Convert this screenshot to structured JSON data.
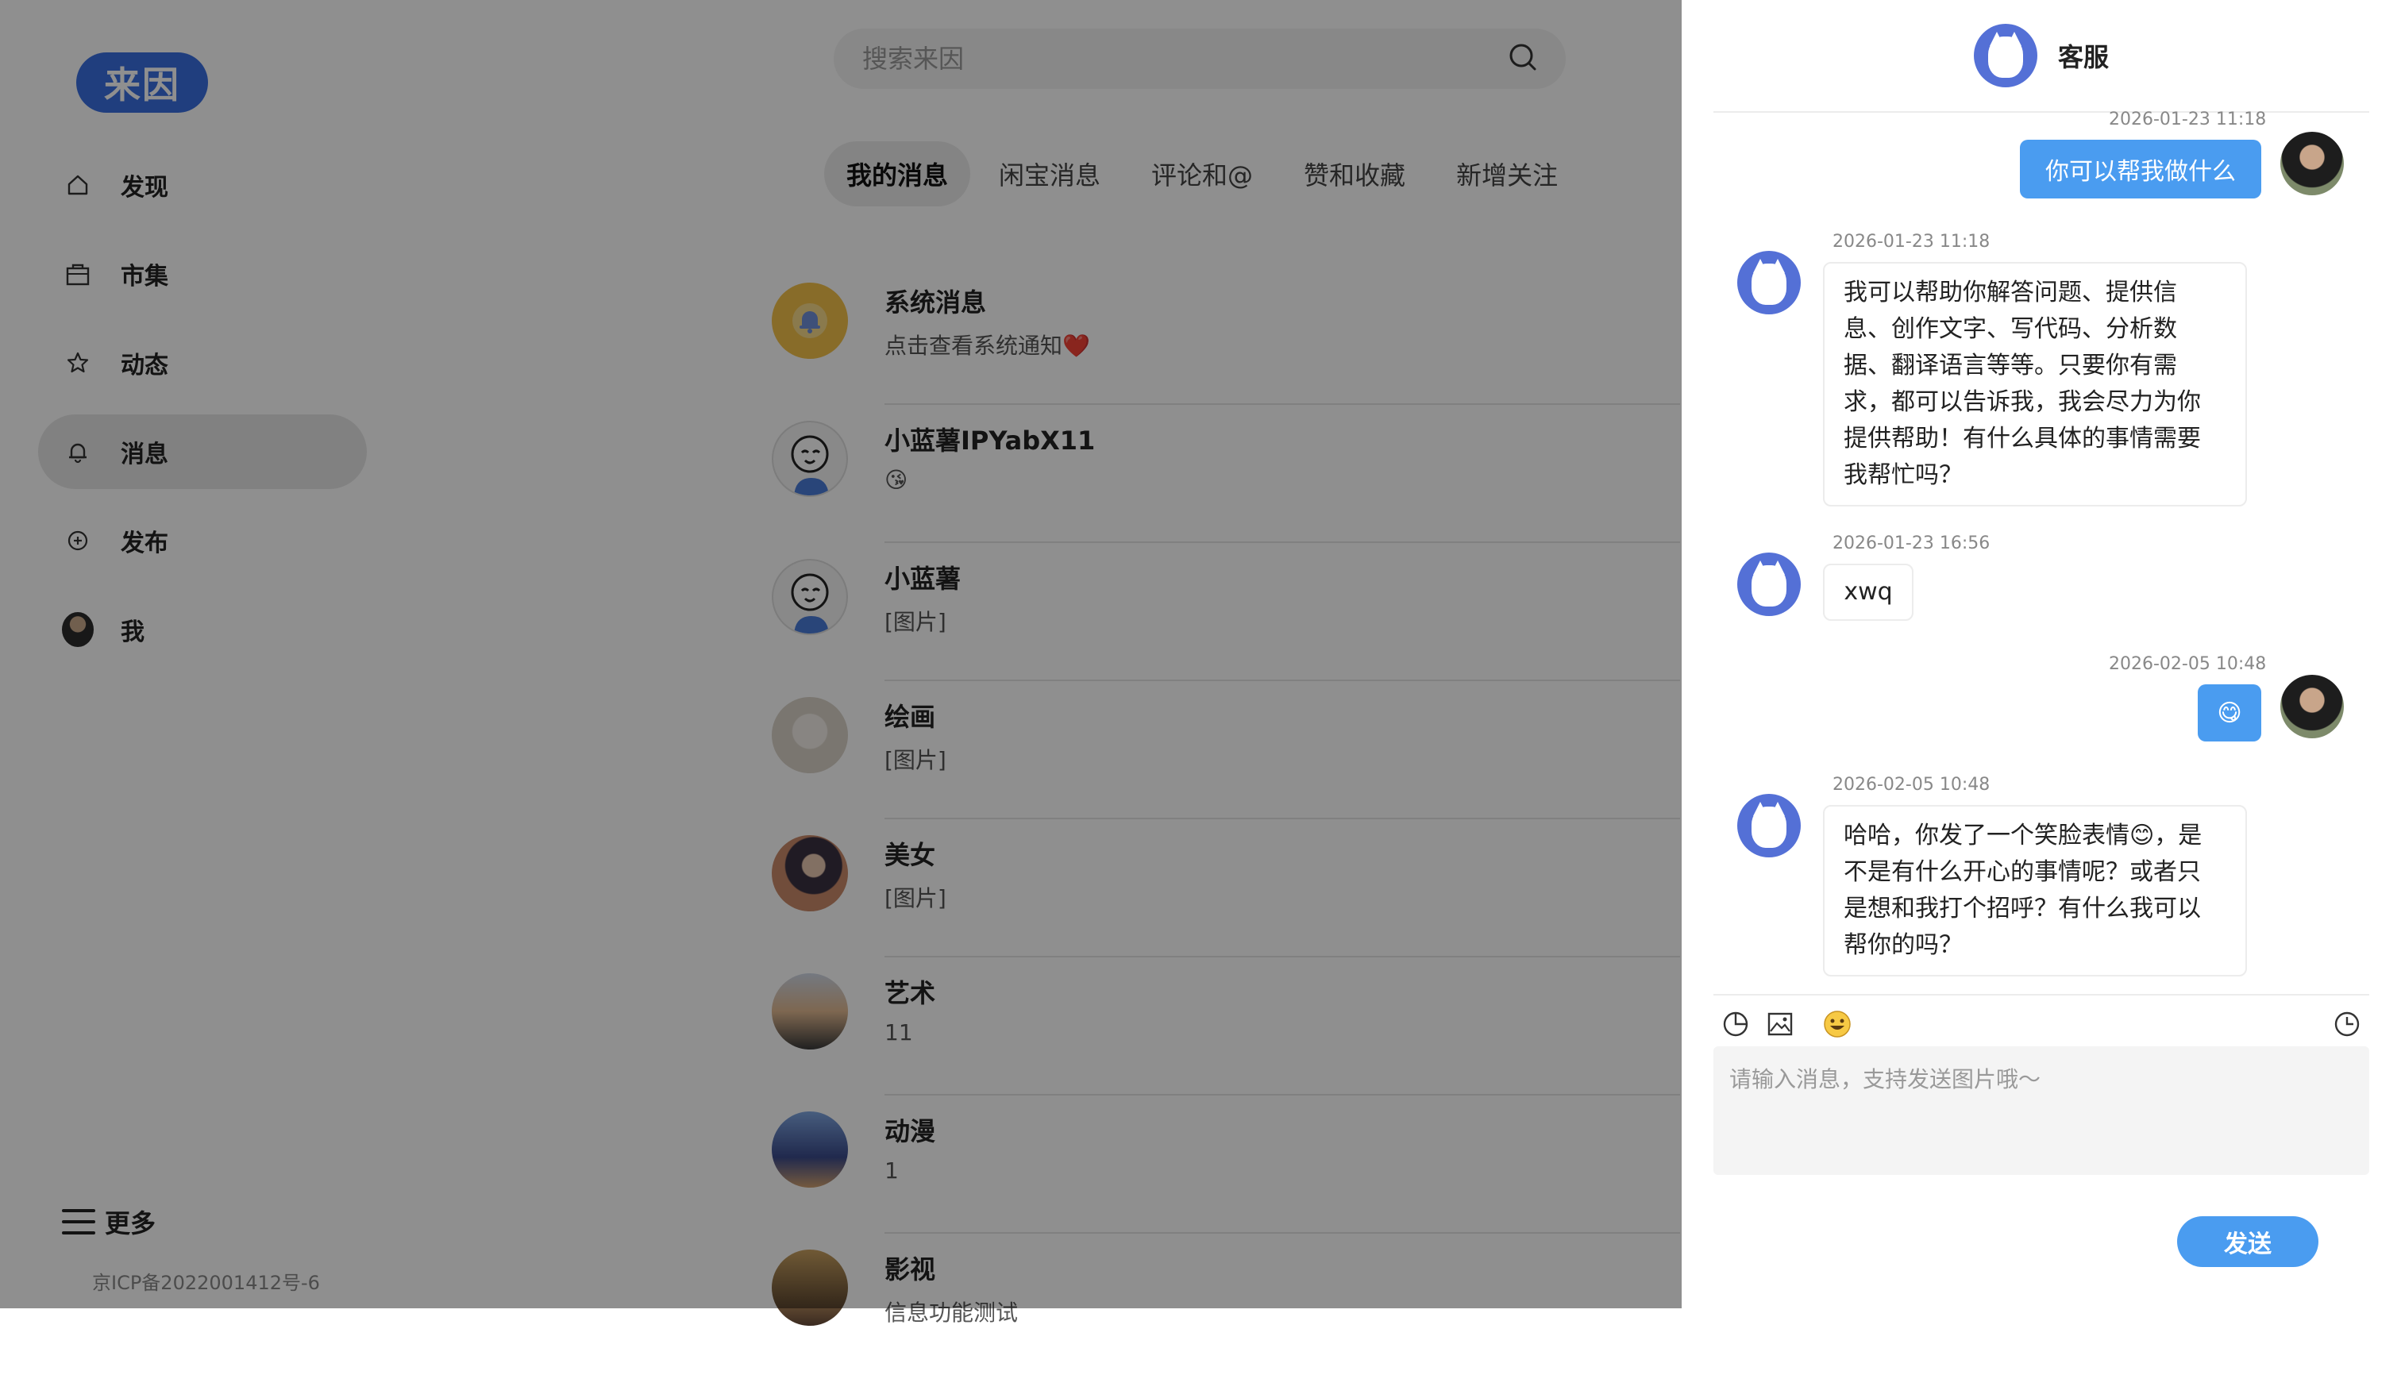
{
  "app": {
    "logo_text": "来因",
    "brand_color": "#3a6fe0",
    "accent_color": "#4a9cf0"
  },
  "sidebar": {
    "items": [
      {
        "label": "发现",
        "icon": "home-icon"
      },
      {
        "label": "市集",
        "icon": "shopping-bag-icon"
      },
      {
        "label": "动态",
        "icon": "star-icon"
      },
      {
        "label": "消息",
        "icon": "bell-icon",
        "active": true
      },
      {
        "label": "发布",
        "icon": "plus-circle-icon"
      },
      {
        "label": "我",
        "icon": "avatar"
      }
    ],
    "more_label": "更多",
    "icp": "京ICP备2022001412号-6"
  },
  "search": {
    "placeholder": "搜索来因"
  },
  "tabs": [
    {
      "label": "我的消息",
      "active": true
    },
    {
      "label": "闲宝消息"
    },
    {
      "label": "评论和@"
    },
    {
      "label": "赞和收藏"
    },
    {
      "label": "新增关注"
    }
  ],
  "conversations": [
    {
      "name": "系统消息",
      "preview": "点击查看系统通知❤️"
    },
    {
      "name": "小蓝薯IPYabX11",
      "preview": "😘"
    },
    {
      "name": "小蓝薯",
      "preview": "[图片]"
    },
    {
      "name": "绘画",
      "preview": "[图片]"
    },
    {
      "name": "美女",
      "preview": "[图片]"
    },
    {
      "name": "艺术",
      "preview": "11"
    },
    {
      "name": "动漫",
      "preview": "1"
    },
    {
      "name": "影视",
      "preview": "信息功能测试"
    }
  ],
  "chat": {
    "title": "客服",
    "messages": [
      {
        "from": "me",
        "time": "2026-01-23 11:18",
        "text": "你可以帮我做什么"
      },
      {
        "from": "bot",
        "time": "2026-01-23 11:18",
        "lines": [
          "我可以帮助你解答问题、提供信",
          "息、创作文字、写代码、分析数",
          "据、翻译语言等等。只要你有需",
          "求，都可以告诉我，我会尽力为你",
          "提供帮助！有什么具体的事情需要",
          "我帮忙吗？"
        ]
      },
      {
        "from": "bot",
        "time": "2026-01-23 16:56",
        "text": "xwq"
      },
      {
        "from": "me",
        "time": "2026-02-05 10:48",
        "text": "😋"
      },
      {
        "from": "bot",
        "time": "2026-02-05 10:48",
        "lines": [
          "哈哈，你发了一个笑脸表情😊，是",
          "不是有什么开心的事情呢？或者只",
          "是想和我打个招呼？有什么我可以",
          "帮你的吗？"
        ]
      }
    ],
    "input_placeholder": "请输入消息，支持发送图片哦～",
    "send_label": "发送"
  }
}
